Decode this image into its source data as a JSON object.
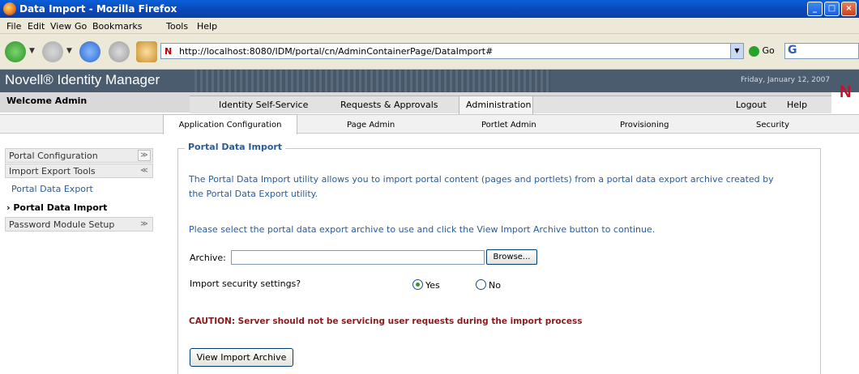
{
  "window": {
    "title": "Data Import - Mozilla Firefox"
  },
  "menu": [
    "File",
    "Edit",
    "View",
    "Go",
    "Bookmarks",
    "Tools",
    "Help"
  ],
  "toolbar": {
    "url": "http://localhost:8080/IDM/portal/cn/AdminContainerPage/DataImport#",
    "go_label": "Go",
    "search_letter": "G"
  },
  "header": {
    "brand": "Novell® Identity Manager",
    "date": "Friday, January 12, 2007",
    "logo": "N"
  },
  "welcome": "Welcome Admin",
  "main_tabs": [
    {
      "label": "Identity Self-Service"
    },
    {
      "label": "Requests & Approvals"
    },
    {
      "label": "Administration",
      "active": true
    },
    {
      "label": "Logout"
    },
    {
      "label": "Help"
    }
  ],
  "sub_tabs": [
    {
      "label": "Application Configuration",
      "active": true
    },
    {
      "label": "Page Admin"
    },
    {
      "label": "Portlet Admin"
    },
    {
      "label": "Provisioning"
    },
    {
      "label": "Security"
    }
  ],
  "sidebar": {
    "items": [
      {
        "label": "Portal Configuration",
        "icon": "expand-icon"
      },
      {
        "label": "Import Export Tools",
        "icon": "collapse-icon"
      },
      {
        "label": "Portal Data Export"
      },
      {
        "label": "Portal Data Import",
        "current": true
      },
      {
        "label": "Password Module Setup",
        "icon": "expand-icon"
      }
    ]
  },
  "content": {
    "legend": "Portal Data Import",
    "intro_line1": "The Portal Data Import utility allows you to import portal content (pages and portlets) from a portal data export archive created by",
    "intro_line2": "the Portal Data Export utility.",
    "instructions": "Please select the portal data export archive to use and click the View Import Archive button to continue.",
    "archive_label": "Archive:",
    "archive_value": "",
    "browse_label": "Browse...",
    "security_question": "Import security settings?",
    "yes_label": "Yes",
    "no_label": "No",
    "security_selected": "Yes",
    "caution": "CAUTION: Server should not be servicing user requests during the import process",
    "view_button": "View Import Archive"
  }
}
